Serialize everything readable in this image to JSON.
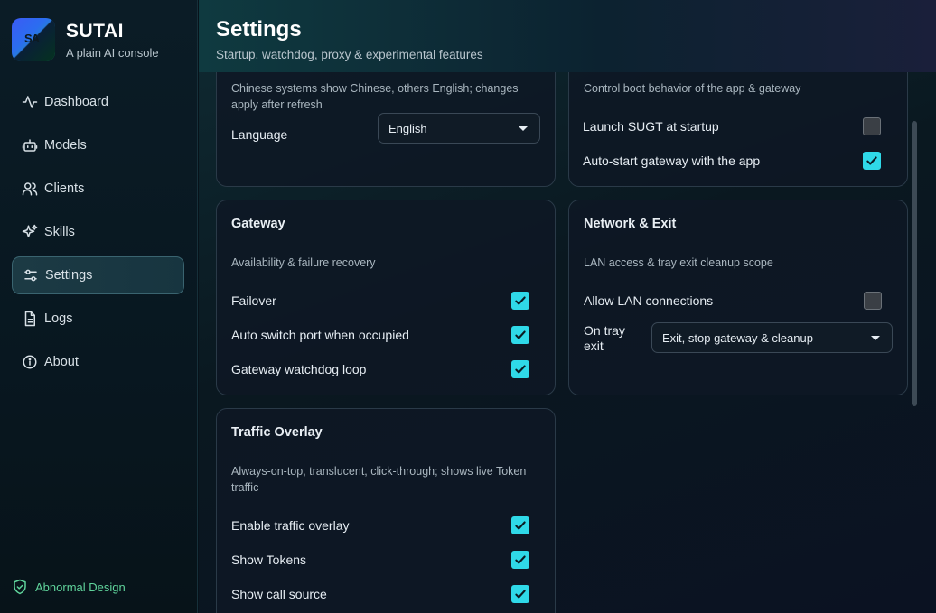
{
  "brand": {
    "logo_text": "SA",
    "name": "SUTAI",
    "subtitle": "A plain AI console"
  },
  "nav": [
    {
      "label": "Dashboard",
      "icon": "activity-icon"
    },
    {
      "label": "Models",
      "icon": "robot-icon"
    },
    {
      "label": "Clients",
      "icon": "users-icon"
    },
    {
      "label": "Skills",
      "icon": "sparkles-icon"
    },
    {
      "label": "Settings",
      "icon": "sliders-icon",
      "active": true
    },
    {
      "label": "Logs",
      "icon": "file-icon"
    },
    {
      "label": "About",
      "icon": "info-icon"
    }
  ],
  "footer": {
    "label": "Abnormal Design",
    "icon": "shield-check-icon"
  },
  "header": {
    "title": "Settings",
    "subtitle": "Startup, watchdog, proxy & experimental features"
  },
  "language_card": {
    "description": "Chinese systems show Chinese, others English; changes apply after refresh",
    "language_label": "Language",
    "language_value": "English"
  },
  "startup_card": {
    "description": "Control boot behavior of the app & gateway",
    "rows": [
      {
        "label": "Launch SUGT at startup",
        "checked": false
      },
      {
        "label": "Auto-start gateway with the app",
        "checked": true
      }
    ]
  },
  "gateway_card": {
    "title": "Gateway",
    "description": "Availability & failure recovery",
    "rows": [
      {
        "label": "Failover",
        "checked": true
      },
      {
        "label": "Auto switch port when occupied",
        "checked": true
      },
      {
        "label": "Gateway watchdog loop",
        "checked": true
      }
    ]
  },
  "network_card": {
    "title": "Network & Exit",
    "description": "LAN access & tray exit cleanup scope",
    "lan_label": "Allow LAN connections",
    "lan_checked": false,
    "tray_label_1": "On tray",
    "tray_label_2": "exit",
    "tray_value": "Exit, stop gateway & cleanup"
  },
  "overlay_card": {
    "title": "Traffic Overlay",
    "description": "Always-on-top, translucent, click-through; shows live Token traffic",
    "rows": [
      {
        "label": "Enable traffic overlay",
        "checked": true
      },
      {
        "label": "Show Tokens",
        "checked": true
      },
      {
        "label": "Show call source",
        "checked": true
      }
    ]
  },
  "colors": {
    "accent": "#2fd9e8",
    "footer_green": "#5fd39b"
  }
}
